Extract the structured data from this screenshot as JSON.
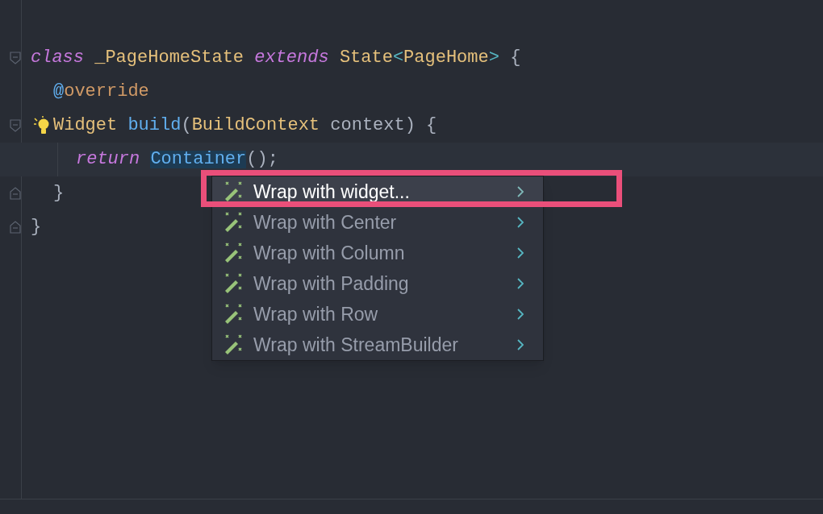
{
  "editor": {
    "lines": [
      {
        "fold_open": true,
        "fold_close": false,
        "bulb": false,
        "current": false,
        "tokens": [
          {
            "kind": "keyword",
            "text": "class "
          },
          {
            "kind": "type",
            "text": "_PageHomeState "
          },
          {
            "kind": "keyword",
            "text": "extends "
          },
          {
            "kind": "type",
            "text": "State"
          },
          {
            "kind": "generic",
            "text": "<"
          },
          {
            "kind": "type",
            "text": "PageHome"
          },
          {
            "kind": "generic",
            "text": ">"
          },
          {
            "kind": "plain",
            "text": " {"
          }
        ],
        "children": [
          {
            "fold_open": false,
            "fold_close": false,
            "bulb": false,
            "current": false,
            "tokens": [
              {
                "kind": "at",
                "text": "@"
              },
              {
                "kind": "annotation",
                "text": "override"
              }
            ]
          },
          {
            "fold_open": true,
            "fold_close": false,
            "bulb": true,
            "current": false,
            "tokens": [
              {
                "kind": "type",
                "text": "Widget "
              },
              {
                "kind": "function",
                "text": "build"
              },
              {
                "kind": "plain",
                "text": "("
              },
              {
                "kind": "type",
                "text": "BuildContext "
              },
              {
                "kind": "plain",
                "text": "context) {"
              }
            ],
            "children": [
              {
                "fold_open": false,
                "fold_close": false,
                "bulb": false,
                "current": true,
                "tokens": [
                  {
                    "kind": "keyword",
                    "text": "return "
                  },
                  {
                    "kind": "selected",
                    "text": "Container"
                  },
                  {
                    "kind": "plain",
                    "text": "();"
                  }
                ]
              }
            ]
          },
          {
            "fold_open": false,
            "fold_close": true,
            "bulb": false,
            "current": false,
            "tokens": [
              {
                "kind": "plain",
                "text": "}"
              }
            ]
          }
        ]
      },
      {
        "fold_open": false,
        "fold_close": true,
        "bulb": false,
        "current": false,
        "tokens": [
          {
            "kind": "plain",
            "text": "}"
          }
        ]
      }
    ]
  },
  "menu": {
    "items": [
      {
        "label": "Wrap with widget...",
        "selected": true
      },
      {
        "label": "Wrap with Center",
        "selected": false
      },
      {
        "label": "Wrap with Column",
        "selected": false
      },
      {
        "label": "Wrap with Padding",
        "selected": false
      },
      {
        "label": "Wrap with Row",
        "selected": false
      },
      {
        "label": "Wrap with StreamBuilder",
        "selected": false
      }
    ]
  },
  "highlight_frame": {
    "on": true
  }
}
